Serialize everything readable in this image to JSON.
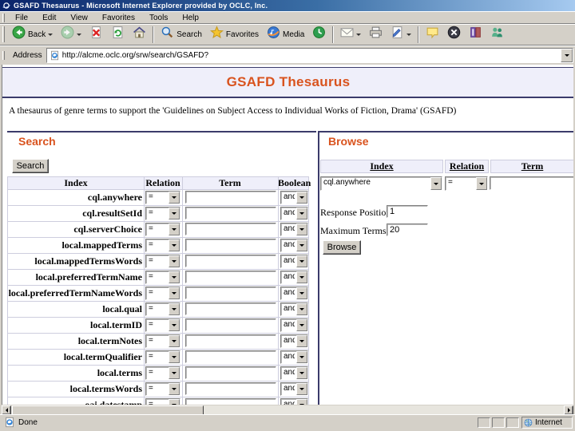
{
  "window": {
    "title": "GSAFD Thesaurus - Microsoft Internet Explorer provided by OCLC, Inc.",
    "status_left": "Done",
    "status_right": "Internet"
  },
  "menu": [
    "File",
    "Edit",
    "View",
    "Favorites",
    "Tools",
    "Help"
  ],
  "toolbar": [
    {
      "name": "back",
      "label": "Back",
      "dropdown": true
    },
    {
      "name": "forward",
      "label": "",
      "dropdown": true
    },
    {
      "name": "stop",
      "label": ""
    },
    {
      "name": "refresh",
      "label": ""
    },
    {
      "name": "home",
      "label": ""
    },
    {
      "name": "sep",
      "label": ""
    },
    {
      "name": "search",
      "label": "Search"
    },
    {
      "name": "favorites",
      "label": "Favorites"
    },
    {
      "name": "media",
      "label": "Media"
    },
    {
      "name": "history",
      "label": ""
    },
    {
      "name": "sep",
      "label": ""
    },
    {
      "name": "mail",
      "label": "",
      "dropdown": true
    },
    {
      "name": "print",
      "label": ""
    },
    {
      "name": "edit",
      "label": "",
      "dropdown": true
    },
    {
      "name": "sep",
      "label": ""
    },
    {
      "name": "discuss",
      "label": ""
    },
    {
      "name": "power",
      "label": ""
    },
    {
      "name": "research",
      "label": ""
    },
    {
      "name": "messenger",
      "label": ""
    }
  ],
  "address": {
    "label": "Address",
    "url": "http://alcme.oclc.org/srw/search/GSAFD?"
  },
  "page": {
    "title": "GSAFD Thesaurus",
    "description": "A thesaurus of genre terms to support the 'Guidelines on Subject Access to Individual Works of Fiction, Drama' (GSAFD)",
    "search": {
      "heading": "Search",
      "button_label": "Search",
      "columns": [
        "Index",
        "Relation",
        "Term",
        "Boolean"
      ],
      "relation_value": "=",
      "boolean_value": "and",
      "term_value": "",
      "indexes": [
        "cql.anywhere",
        "cql.resultSetId",
        "cql.serverChoice",
        "local.mappedTerms",
        "local.mappedTermsWords",
        "local.preferredTermName",
        "local.preferredTermNameWords",
        "local.qual",
        "local.termID",
        "local.termNotes",
        "local.termQualifier",
        "local.terms",
        "local.termsWords",
        "oai.datestamp"
      ]
    },
    "browse": {
      "heading": "Browse",
      "columns": [
        "Index",
        "Relation",
        "Term"
      ],
      "index_value": "cql.anywhere",
      "relation_value": "=",
      "term_value": "",
      "response_position_label": "Response Position:",
      "response_position_value": "1",
      "maximum_terms_label": "Maximum Terms:",
      "maximum_terms_value": "20",
      "button_label": "Browse"
    }
  },
  "colors": {
    "accent_orange": "#d9531e",
    "navy_rule": "#3b3b6b",
    "masthead_bg": "#efeffa",
    "chrome_gray": "#d4d0c8",
    "titlebar_left": "#0a246a",
    "titlebar_right": "#a6caf0"
  }
}
